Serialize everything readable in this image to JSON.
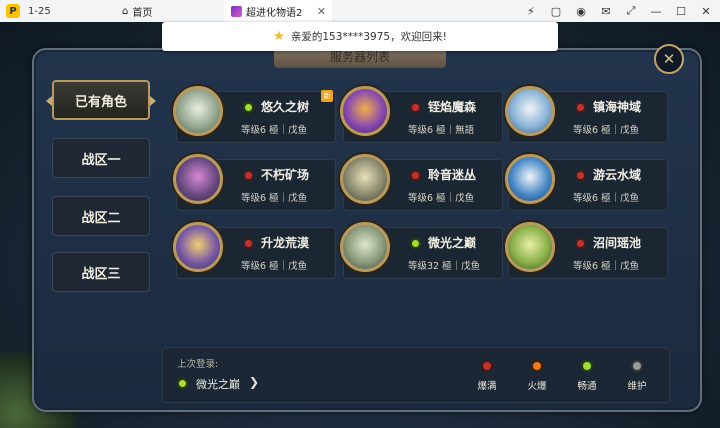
{
  "window": {
    "app_logo_letter": "P",
    "version": "1-25",
    "home_label": "首页",
    "tab_title": "超进化物语2",
    "tab_close": "✕",
    "tools": [
      "⚡",
      "▢",
      "◉",
      "✉",
      "⤢",
      "—",
      "☐",
      "✕"
    ]
  },
  "toast": {
    "star": "★",
    "message": "亲爱的153****3975，欢迎回来!"
  },
  "panel": {
    "title": "服务器列表",
    "close": "✕"
  },
  "sidebar": [
    {
      "label": "已有角色",
      "active": true
    },
    {
      "label": "战区一",
      "active": false
    },
    {
      "label": "战区二",
      "active": false
    },
    {
      "label": "战区三",
      "active": false
    }
  ],
  "servers": [
    {
      "name": "悠久之树",
      "level": "等级6 極｜戊鱼",
      "status": "畅通",
      "new_badge": "新"
    },
    {
      "name": "铚焰魔森",
      "level": "等级6 極｜無語",
      "status": "爆满"
    },
    {
      "name": "镇海神域",
      "level": "等级6 極｜戊鱼",
      "status": "爆满"
    },
    {
      "name": "不朽矿场",
      "level": "等级6 極｜戊鱼",
      "status": "爆满"
    },
    {
      "name": "聆音迷丛",
      "level": "等级6 極｜戊鱼",
      "status": "爆满"
    },
    {
      "name": "游云水域",
      "level": "等级6 極｜戊鱼",
      "status": "爆满"
    },
    {
      "name": "升龙荒漠",
      "level": "等级6 極｜戊鱼",
      "status": "爆满"
    },
    {
      "name": "微光之巅",
      "level": "等级32 極｜戊鱼",
      "status": "畅通"
    },
    {
      "name": "沼间瑶池",
      "level": "等级6 極｜戊鱼",
      "status": "爆满"
    }
  ],
  "footer": {
    "last_login_label": "上次登录:",
    "last_login_server": "微光之巅",
    "arrow": "❯",
    "legend": [
      {
        "label": "爆满",
        "color": "#d23a2a"
      },
      {
        "label": "火爆",
        "color": "#f07a1a"
      },
      {
        "label": "畅通",
        "color": "#9be02a"
      },
      {
        "label": "维护",
        "color": "#9a9a9a"
      }
    ]
  },
  "colors": {
    "爆满": "#c8302a",
    "畅通": "#9be02a",
    "accent_gold": "#b89a5e"
  }
}
